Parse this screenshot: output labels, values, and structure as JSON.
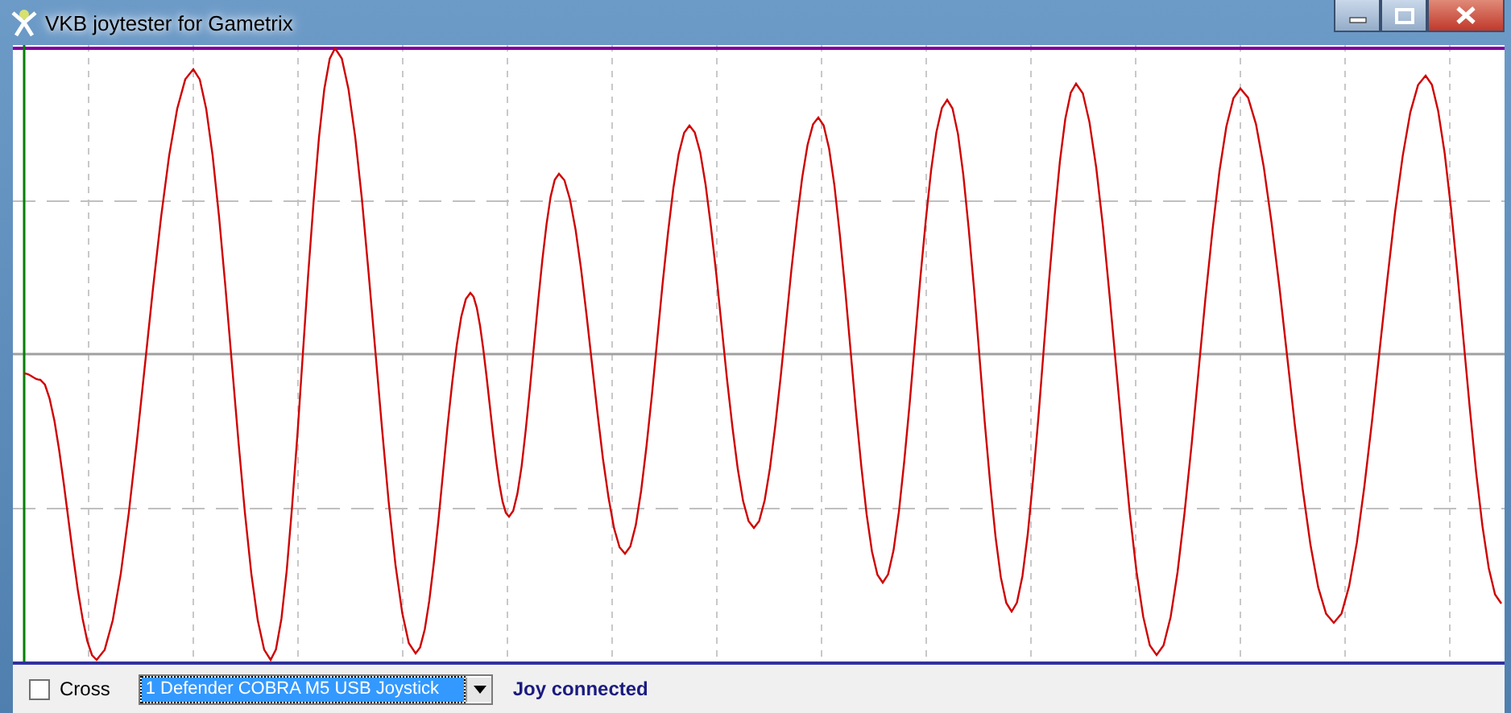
{
  "window": {
    "title": "VKB joytester for Gametrix"
  },
  "controls": {
    "cross": {
      "label": "Cross",
      "checked": false
    },
    "device": {
      "value": "1 Defender COBRA M5 USB Joystick",
      "focused": true
    },
    "status": "Joy connected"
  }
}
